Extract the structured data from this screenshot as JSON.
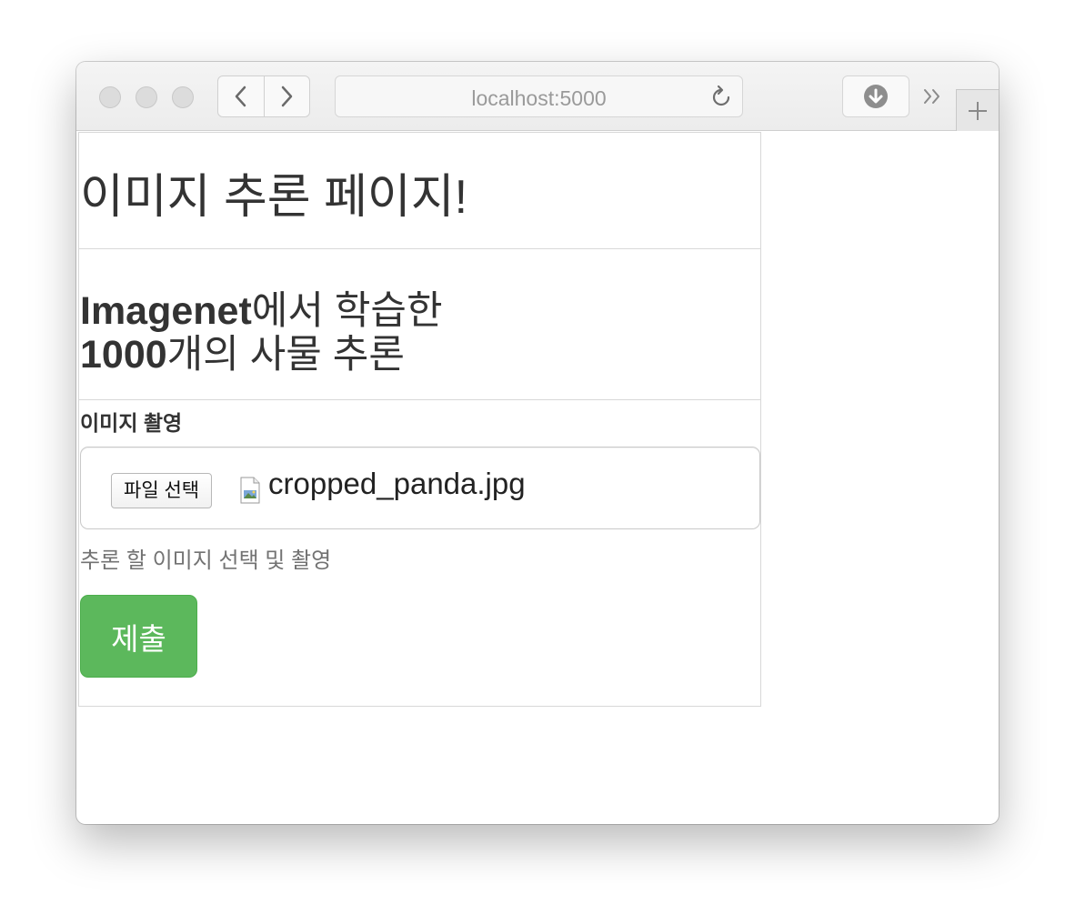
{
  "browser": {
    "address": "localhost:5000",
    "icons": {
      "back": "chevron-left-icon",
      "forward": "chevron-right-icon",
      "reload": "reload-icon",
      "download": "download-icon",
      "more": "double-chevron-right-icon",
      "new_tab": "plus-icon"
    }
  },
  "page": {
    "title": "이미지 추론 페이지!",
    "subtitle_bold_1": "Imagenet",
    "subtitle_rest_1": "에서 학습한",
    "subtitle_bold_2": "1000",
    "subtitle_rest_2": "개의 사물 추론"
  },
  "form": {
    "label": "이미지 촬영",
    "file_button": "파일 선택",
    "file_name": "cropped_panda.jpg",
    "help_text": "추론 할 이미지 선택 및 촬영",
    "submit_label": "제출"
  },
  "colors": {
    "submit_bg": "#5cb85c",
    "text": "#333333",
    "help_text": "#737373"
  }
}
